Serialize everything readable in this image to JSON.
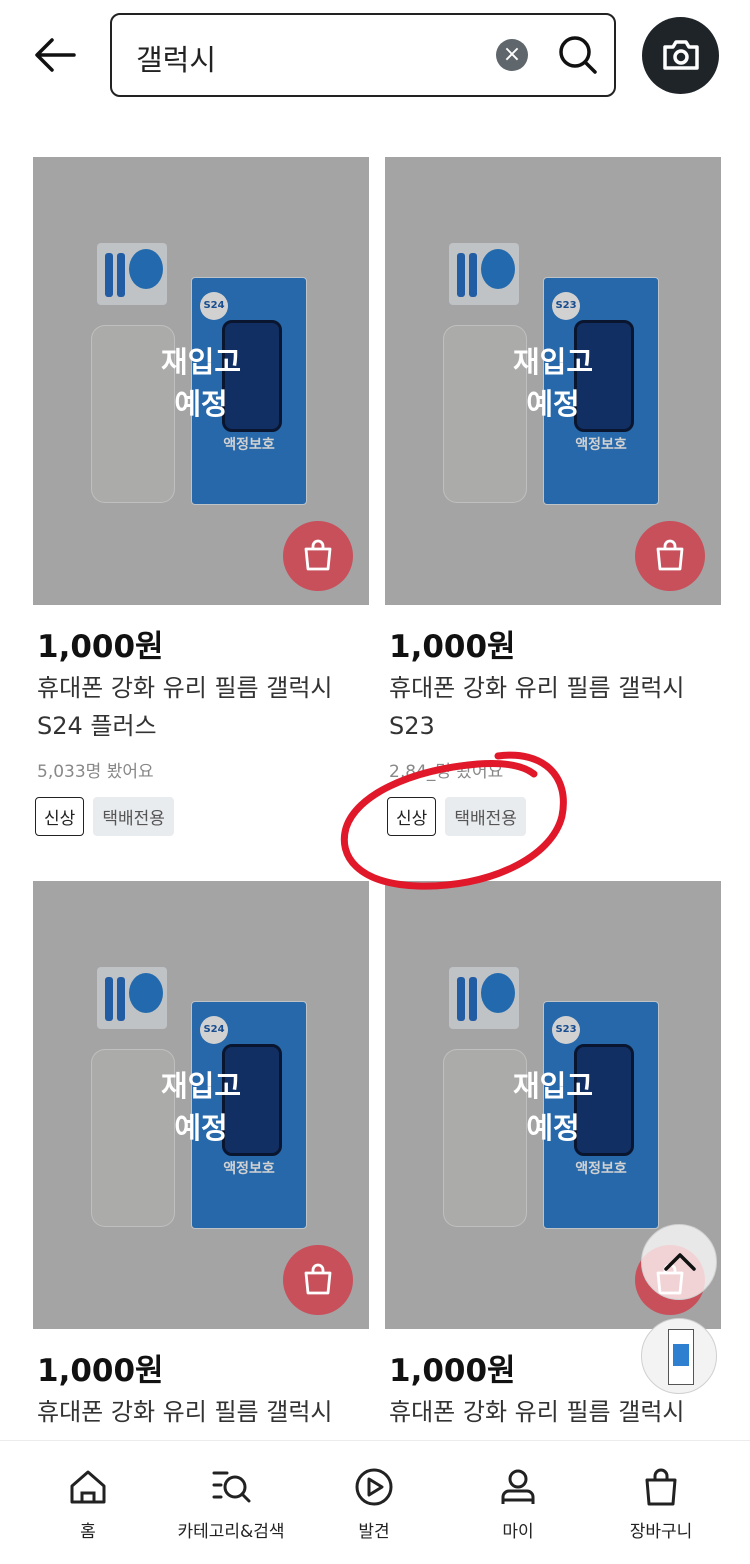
{
  "header": {
    "search_value": "갤럭시",
    "icons": [
      "back-arrow-icon",
      "clear-icon",
      "search-icon",
      "camera-icon"
    ]
  },
  "products": [
    {
      "restock": [
        "재입고",
        "예정"
      ],
      "model": "S24",
      "pack_label": "액정보호",
      "price": "1,000원",
      "title_line1": "휴대폰 강화 유리 필름 갤럭시",
      "title_line2": "S24 플러스",
      "views": "5,033명 봤어요",
      "tag_new": "신상",
      "tag_ship": "택배전용"
    },
    {
      "restock": [
        "재입고",
        "예정"
      ],
      "model": "S23",
      "pack_label": "액정보호",
      "price": "1,000원",
      "title_line1": "휴대폰 강화 유리 필름 갤럭시",
      "title_line2": "S23",
      "views": "2,84_명 봤어요",
      "tag_new": "신상",
      "tag_ship": "택배전용"
    },
    {
      "restock": [
        "재입고",
        "예정"
      ],
      "model": "S24",
      "pack_label": "액정보호",
      "price": "1,000원",
      "title_line1": "휴대폰 강화 유리 필름 갤럭시"
    },
    {
      "restock": [
        "재입고",
        "예정"
      ],
      "model": "S23",
      "pack_label": "액정보호",
      "price": "1,000원",
      "title_line1": "휴대폰 강화 유리 필름 갤럭시"
    }
  ],
  "bottom_nav": [
    {
      "label": "홈",
      "icon": "home-icon"
    },
    {
      "label": "카테고리&검색",
      "icon": "category-search-icon"
    },
    {
      "label": "발견",
      "icon": "discover-icon"
    },
    {
      "label": "마이",
      "icon": "person-icon"
    },
    {
      "label": "장바구니",
      "icon": "cart-icon"
    }
  ],
  "colors": {
    "cart_button": "#c7505b",
    "camera_button": "#1f2428",
    "annotation": "#e0182a"
  }
}
